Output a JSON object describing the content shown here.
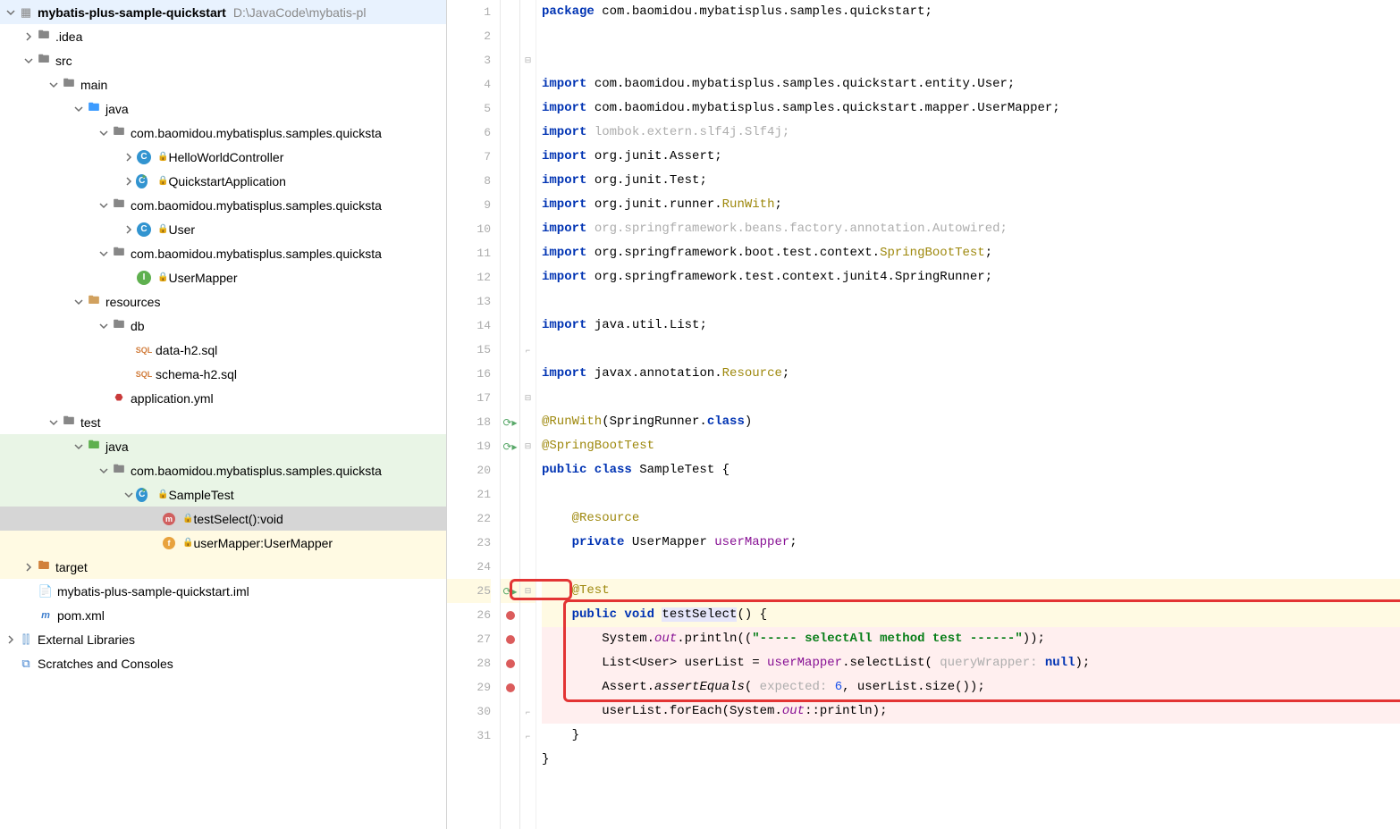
{
  "project": {
    "root": "mybatis-plus-sample-quickstart",
    "rootPath": "D:\\JavaCode\\mybatis-pl",
    "tree": {
      "idea": ".idea",
      "src": "src",
      "main": "main",
      "java1": "java",
      "pkg1": "com.baomidou.mybatisplus.samples.quicksta",
      "hello": "HelloWorldController",
      "app": "QuickstartApplication",
      "pkg2": "com.baomidou.mybatisplus.samples.quicksta",
      "user": "User",
      "pkg3": "com.baomidou.mybatisplus.samples.quicksta",
      "mapper": "UserMapper",
      "resources": "resources",
      "db": "db",
      "data_sql": "data-h2.sql",
      "schema_sql": "schema-h2.sql",
      "app_yml": "application.yml",
      "test": "test",
      "java2": "java",
      "pkg4": "com.baomidou.mybatisplus.samples.quicksta",
      "sample": "SampleTest",
      "testSelect": "testSelect():void",
      "userMapperF": "userMapper:UserMapper",
      "target": "target",
      "iml": "mybatis-plus-sample-quickstart.iml",
      "pom": "pom.xml",
      "extlib": "External Libraries",
      "scratches": "Scratches and Consoles"
    }
  },
  "code": {
    "l1": "package com.baomidou.mybatisplus.samples.quickstart;",
    "l2": "",
    "l3": "",
    "l4a": "import",
    "l4b": " com.baomidou.mybatisplus.samples.quickstart.entity.User;",
    "l5a": "import",
    "l5b": " com.baomidou.mybatisplus.samples.quickstart.mapper.UserMapper;",
    "l6a": "import",
    "l6b": " lombok.extern.slf4j.Slf4j;",
    "l7a": "import",
    "l7b": " org.junit.Assert;",
    "l8a": "import",
    "l8b": " org.junit.Test;",
    "l9a": "import",
    "l9b": " org.junit.runner.",
    "l9c": "RunWith",
    "l9d": ";",
    "l10a": "import",
    "l10b": " org.springframework.beans.factory.annotation.Autowired;",
    "l11a": "import",
    "l11b": " org.springframework.boot.test.context.",
    "l11c": "SpringBootTest",
    "l11d": ";",
    "l12a": "import",
    "l12b": " org.springframework.test.context.junit4.SpringRunner;",
    "l13": "",
    "l14a": "import",
    "l14b": " java.util.List;",
    "l15": "",
    "l16a": "import",
    "l16b": " javax.annotation.",
    "l16c": "Resource",
    "l16d": ";",
    "l17": "",
    "l18": "@RunWith",
    "l18b": "(SpringRunner.",
    "l18c": "class",
    "l18d": ")",
    "l19": "@SpringBootTest",
    "l20a": "public class ",
    "l20b": "SampleTest {",
    "l21": "",
    "l22": "    @Resource",
    "l23a": "    private ",
    "l23b": "UserMapper ",
    "l23c": "userMapper",
    "l23d": ";",
    "l24": "",
    "l25": "    @Test",
    "l26a": "    public void ",
    "l26b": "testSelect",
    "l26c": "() {",
    "l27a": "        System.",
    "l27b": "out",
    "l27c": ".println((",
    "l27d": "\"----- selectAll method test ------\"",
    "l27e": "));",
    "l28a": "        List<User> userList = ",
    "l28b": "userMapper",
    "l28c": ".selectList( ",
    "l28hint": "queryWrapper: ",
    "l28d": "null",
    "l28e": ");",
    "l29a": "        Assert.",
    "l29b": "assertEquals",
    "l29c": "( ",
    "l29hint": "expected: ",
    "l29d": "6",
    "l29e": ", userList.size());",
    "l30a": "        userList.forEach(System.",
    "l30b": "out",
    "l30c": "::println);",
    "l31": "    }",
    "l32": "}"
  },
  "gutter": [
    "1",
    "2",
    "3",
    "4",
    "5",
    "6",
    "7",
    "8",
    "9",
    "10",
    "11",
    "12",
    "13",
    "14",
    "15",
    "16",
    "17",
    "18",
    "19",
    "20",
    "21",
    "22",
    "23",
    "24",
    "25",
    "26",
    "27",
    "28",
    "29",
    "30",
    "31"
  ]
}
